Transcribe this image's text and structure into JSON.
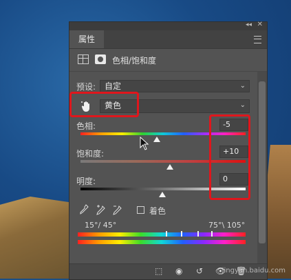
{
  "window": {
    "tab_label": "属性",
    "collapse_glyph": "◂◂",
    "close_glyph": "✕"
  },
  "header": {
    "title": "色相/饱和度"
  },
  "preset": {
    "label": "预设:",
    "value": "自定"
  },
  "channel": {
    "value": "黄色"
  },
  "hue": {
    "label": "色相:",
    "value": "-5",
    "level": -0.028
  },
  "saturation": {
    "label": "饱和度:",
    "value": "+10",
    "level": 0.1
  },
  "lightness": {
    "label": "明度:",
    "value": "0",
    "level": 0.0
  },
  "colorize": {
    "label": "着色",
    "checked": false
  },
  "range": {
    "left": "15°/ 45°",
    "right": "75°\\ 105°"
  },
  "watermark": "jingyan.baidu.com",
  "colors": {
    "accent": "#e0161c",
    "panel": "#535353"
  }
}
